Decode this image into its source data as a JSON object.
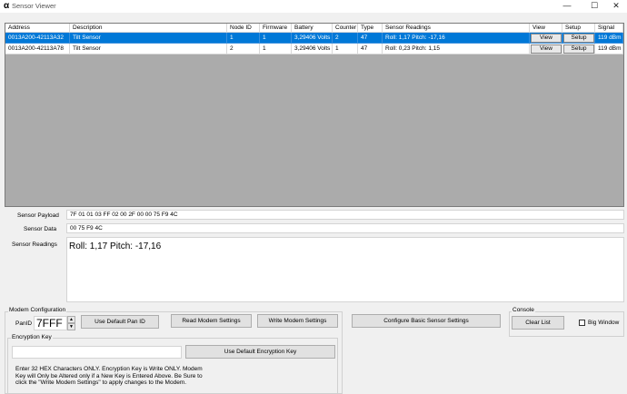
{
  "window": {
    "title": "Sensor Viewer",
    "app_icon": "α",
    "minimize_glyph": "—",
    "maximize_glyph": "☐",
    "close_glyph": "✕"
  },
  "grid": {
    "headers": {
      "address": "Address",
      "description": "Description",
      "node_id": "Node ID",
      "firmware": "Firmware",
      "battery": "Battery",
      "counter": "Counter",
      "type": "Type",
      "sensor_readings": "Sensor Readings",
      "view": "View",
      "setup": "Setup",
      "signal": "Signal"
    },
    "rows": [
      {
        "address": "0013A200-42113A32",
        "description": "Tilt Sensor",
        "node_id": "1",
        "firmware": "1",
        "battery": "3,29406 Volts",
        "counter": "2",
        "type": "47",
        "sensor_readings": "Roll: 1,17 Pitch: -17,16",
        "view_label": "View",
        "setup_label": "Setup",
        "signal": "119 dBm",
        "selected": true
      },
      {
        "address": "0013A200-42113A78",
        "description": "Tilt Sensor",
        "node_id": "2",
        "firmware": "1",
        "battery": "3,29406 Volts",
        "counter": "1",
        "type": "47",
        "sensor_readings": "Roll: 0,23 Pitch: 1,15",
        "view_label": "View",
        "setup_label": "Setup",
        "signal": "119 dBm",
        "selected": false
      }
    ]
  },
  "details": {
    "payload_label": "Sensor Payload",
    "payload_value": "7F 01 01 03 FF 02 00 2F 00 00 75 F9 4C",
    "data_label": "Sensor Data",
    "data_value": "00 75 F9 4C",
    "readings_label": "Sensor Readings",
    "readings_value": "Roll: 1,17 Pitch: -17,16"
  },
  "modem_config": {
    "group_label": "Modem Configuration",
    "panid_label": "PanID",
    "panid_value": "7FFF",
    "use_default_pan_label": "Use Default Pan ID",
    "read_modem_label": "Read Modem Settings",
    "write_modem_label": "Write Modem Settings",
    "configure_sensor_label": "Configure Basic Sensor Settings",
    "encryption_group_label": "Encryption Key",
    "encryption_value": "",
    "use_default_encryption_label": "Use Default Encryption Key",
    "encryption_note": "Enter 32 HEX Characters ONLY.  Encryption Key is Write ONLY.  Modem Key will Only be Altered only if a New Key is Entered Above.  Be Sure to click the \"Write Modem Settings\" to apply changes to the Modem."
  },
  "console": {
    "group_label": "Console",
    "clear_list_label": "Clear List",
    "big_window_label": "Big Window",
    "big_window_checked": false
  }
}
